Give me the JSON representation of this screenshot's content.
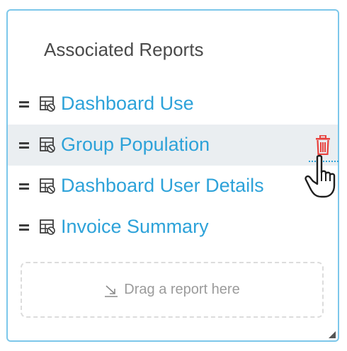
{
  "panel": {
    "title": "Associated Reports",
    "accent_color": "#2da2d9",
    "border_color": "#7cc7ea"
  },
  "reports": [
    {
      "label": "Dashboard Use",
      "icon": "report-grid-icon",
      "hovered": false
    },
    {
      "label": "Group Population",
      "icon": "report-grid-icon",
      "hovered": true
    },
    {
      "label": "Dashboard User Details",
      "icon": "report-grid-icon",
      "hovered": false
    },
    {
      "label": "Invoice Summary",
      "icon": "report-grid-icon",
      "hovered": false
    }
  ],
  "row_actions": {
    "delete_icon": "trash-icon",
    "delete_color": "#e8413d"
  },
  "cursor": {
    "icon": "hand-pointer-icon"
  },
  "drop_zone": {
    "label": "Drag a report here",
    "icon": "drop-arrow-icon"
  }
}
